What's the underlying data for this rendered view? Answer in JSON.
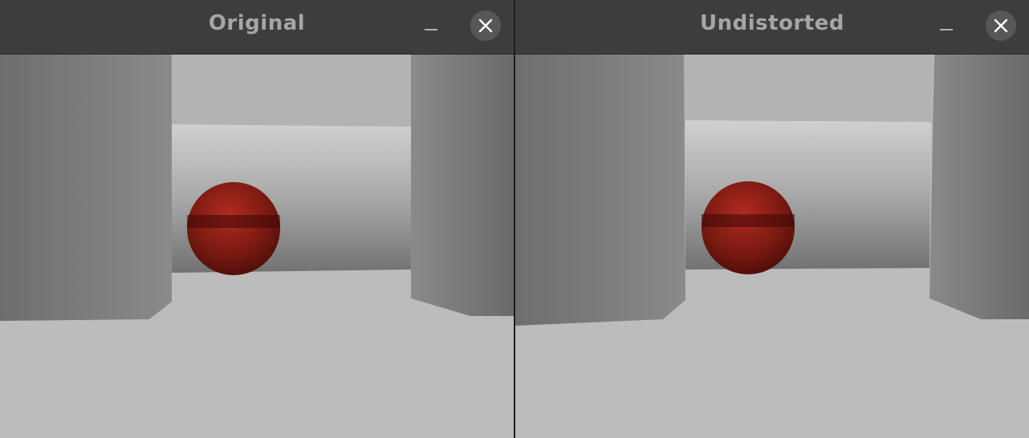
{
  "windows": [
    {
      "title": "Original",
      "icons": {
        "minimize": "minimize-icon",
        "close": "close-icon"
      }
    },
    {
      "title": "Undistorted",
      "icons": {
        "minimize": "minimize-icon",
        "close": "close-icon"
      }
    }
  ],
  "colors": {
    "titlebar": "#3d3d3d",
    "title_text": "#a6a6a6",
    "close_button": "#575757",
    "floor": "#bcbcbc",
    "sphere": "#8e1f17"
  }
}
